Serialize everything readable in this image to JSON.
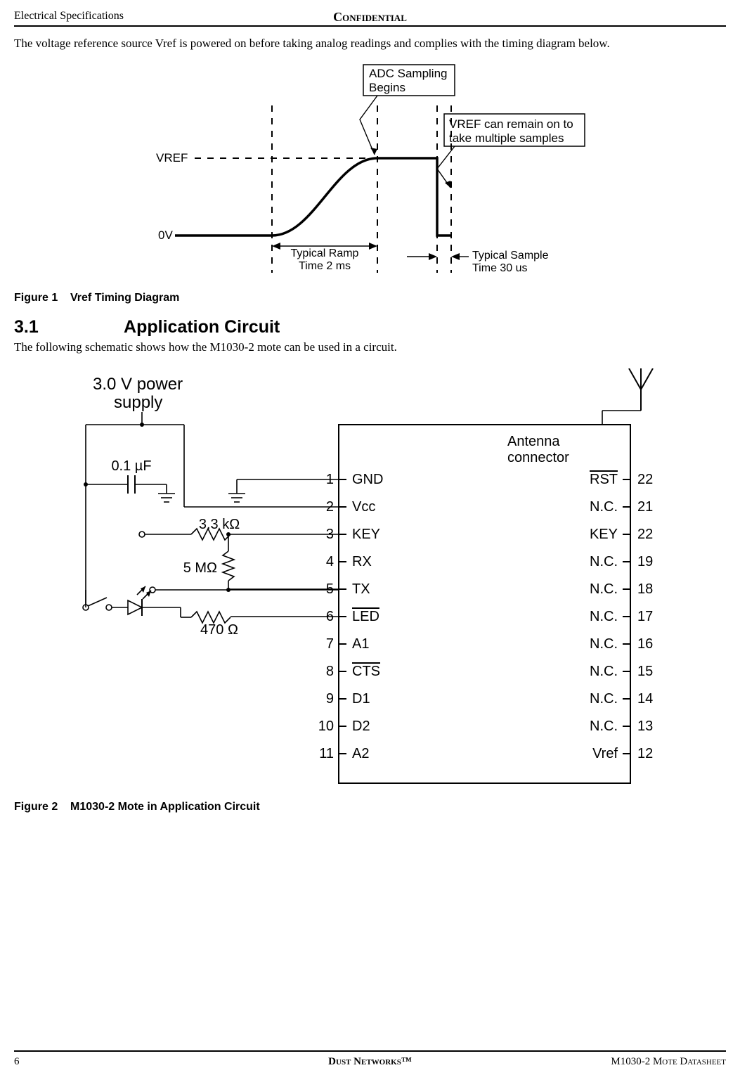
{
  "header": {
    "left": "Electrical Specifications",
    "center": "Confidential"
  },
  "intro": "The voltage reference source Vref is powered on before taking analog readings and complies with the timing diagram below.",
  "figure1": {
    "caption_prefix": "Figure 1",
    "caption_text": "Vref Timing Diagram",
    "labels": {
      "adc_line1": "ADC Sampling",
      "adc_line2": "Begins",
      "vref_remain_line1": "VREF can remain on to",
      "vref_remain_line2": "take multiple samples",
      "vref": "VREF",
      "zero_v": "0V",
      "ramp_line1": "Typical Ramp",
      "ramp_line2": "Time 2 ms",
      "sample_line1": "Typical Sample",
      "sample_line2": "Time 30 us"
    }
  },
  "section": {
    "number": "3.1",
    "title": "Application Circuit",
    "body": "The following schematic shows how the M1030-2 mote can be used in a circuit."
  },
  "figure2": {
    "caption_prefix": "Figure 2",
    "caption_text": "M1030-2 Mote in Application Circuit",
    "power_line1": "3.0 V power",
    "power_line2": "supply",
    "cap_value": "0.1 µF",
    "r1_value": "3.3 kΩ",
    "r2_value": "5 MΩ",
    "r3_value": "470 Ω",
    "antenna_line1": "Antenna",
    "antenna_line2": "connector",
    "left_pins": [
      {
        "num": "1",
        "name": "GND"
      },
      {
        "num": "2",
        "name": "Vcc"
      },
      {
        "num": "3",
        "name": "KEY"
      },
      {
        "num": "4",
        "name": "RX"
      },
      {
        "num": "5",
        "name": "TX"
      },
      {
        "num": "6",
        "name": "LED",
        "overline": true
      },
      {
        "num": "7",
        "name": "A1"
      },
      {
        "num": "8",
        "name": "CTS",
        "overline": true
      },
      {
        "num": "9",
        "name": "D1"
      },
      {
        "num": "10",
        "name": "D2"
      },
      {
        "num": "11",
        "name": "A2"
      }
    ],
    "right_pins": [
      {
        "num": "22",
        "name": "RST",
        "overline": true
      },
      {
        "num": "21",
        "name": "N.C."
      },
      {
        "num": "22",
        "name": "KEY"
      },
      {
        "num": "19",
        "name": "N.C."
      },
      {
        "num": "18",
        "name": "N.C."
      },
      {
        "num": "17",
        "name": "N.C."
      },
      {
        "num": "16",
        "name": "N.C."
      },
      {
        "num": "15",
        "name": "N.C."
      },
      {
        "num": "14",
        "name": "N.C."
      },
      {
        "num": "13",
        "name": "N.C."
      },
      {
        "num": "12",
        "name": "Vref"
      }
    ]
  },
  "footer": {
    "page": "6",
    "center": "Dust Networks™",
    "right": "M1030-2 Mote Datasheet"
  }
}
